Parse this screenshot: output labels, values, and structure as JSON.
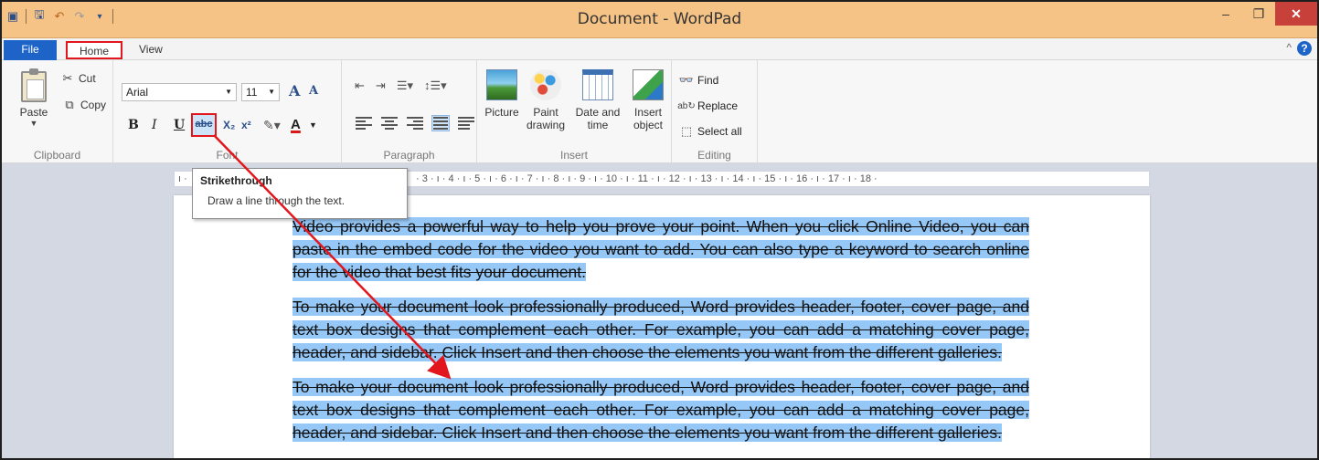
{
  "titlebar": {
    "title": "Document - WordPad",
    "minimize": "–",
    "restore": "❐",
    "close": "✕"
  },
  "menu": {
    "file": "File",
    "home": "Home",
    "view": "View",
    "collapse": "^",
    "help": "?"
  },
  "clipboard": {
    "paste": "Paste",
    "cut": "Cut",
    "copy": "Copy",
    "label": "Clipboard"
  },
  "font": {
    "name": "Arial",
    "size": "11",
    "bold": "B",
    "italic": "I",
    "underline": "U",
    "strike": "abc",
    "subscript": "X₂",
    "superscript": "x²",
    "color": "A",
    "grow": "A",
    "shrink": "A",
    "label": "Font"
  },
  "paragraph": {
    "label": "Paragraph"
  },
  "insert": {
    "picture": "Picture",
    "paint": "Paint drawing",
    "date": "Date and time",
    "object": "Insert object",
    "label": "Insert"
  },
  "editing": {
    "find": "Find",
    "replace": "Replace",
    "select_all": "Select all",
    "label": "Editing"
  },
  "ruler": {
    "marks": "· 3 · ı · 4 · ı · 5 · ı · 6 · ı · 7 · ı · 8 · ı · 9 · ı · 10 · ı · 11 · ı · 12 · ı · 13 · ı · 14 · ı · 15 · ı · 16 · ı · 17 · ı · 18 ·",
    "left_mark": "ı ·"
  },
  "tooltip": {
    "title": "Strikethrough",
    "description": "Draw a line through the text."
  },
  "document": {
    "paragraphs": [
      "Video provides a powerful way to help you prove your point. When you click Online Video, you can paste in the embed code for the video you want to add. You can also type a keyword to search online for the video that best fits your document.",
      "To make your document look professionally produced, Word provides header, footer, cover page, and text box designs that complement each other. For example, you can add a matching cover page, header, and sidebar. Click Insert and then choose the elements you want from the different galleries.",
      "To make your document look professionally produced, Word provides header, footer, cover page, and text box designs that complement each other. For example, you can add a matching cover page, header, and sidebar. Click Insert and then choose the elements you want from the different galleries."
    ]
  },
  "colors": {
    "titlebar": "#f6c386",
    "file_tab": "#1e64c8",
    "highlight_box": "#e2161d",
    "selection": "#96c8f7",
    "close_button": "#c7413a"
  }
}
